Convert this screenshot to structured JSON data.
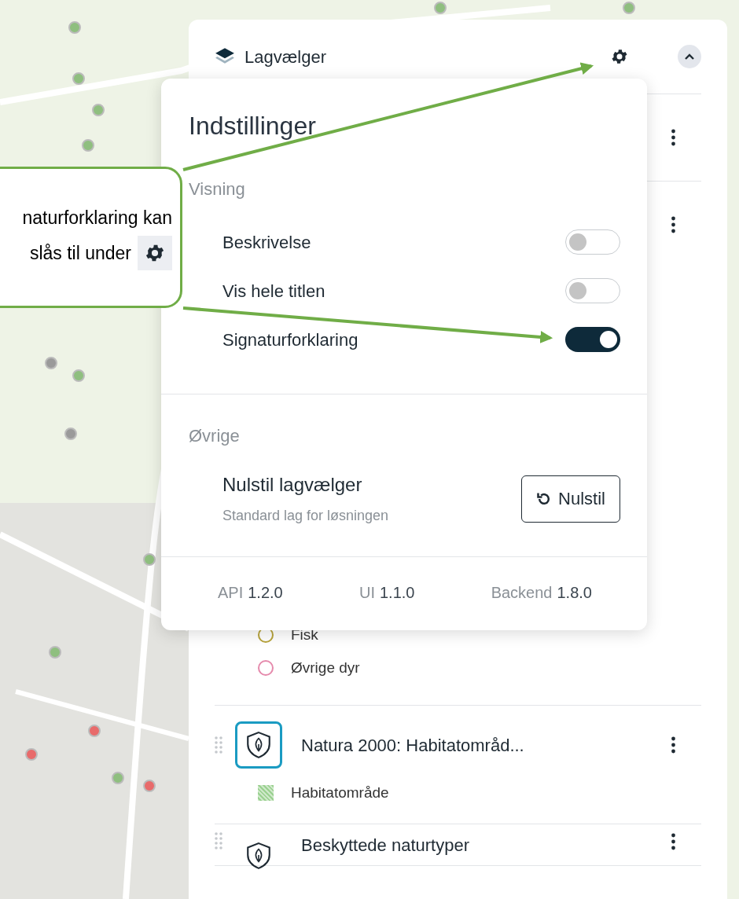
{
  "layer_panel": {
    "title": "Lagvælger",
    "expanded": true
  },
  "layers": [
    {
      "kind": "covered"
    },
    {
      "kind": "covered",
      "legend": [
        {
          "kind": "circle",
          "label": "Fisk",
          "color": "#b8a43c"
        },
        {
          "kind": "circle",
          "label": "Øvrige dyr",
          "color": "#e58aac"
        }
      ]
    },
    {
      "kind": "layer",
      "title": "Natura 2000: Habitatområd...",
      "active": true,
      "legend": [
        {
          "kind": "hatch",
          "label": "Habitatområde",
          "color": "#9bd191"
        }
      ]
    },
    {
      "kind": "layer",
      "title": "Beskyttede naturtyper",
      "active": false
    }
  ],
  "settings": {
    "title": "Indstillinger",
    "sections": [
      {
        "heading": "Visning",
        "toggles": [
          {
            "label": "Beskrivelse",
            "on": false
          },
          {
            "label": "Vis hele titlen",
            "on": false
          },
          {
            "label": "Signaturforklaring",
            "on": true
          }
        ]
      },
      {
        "heading": "Øvrige",
        "reset": {
          "title": "Nulstil lagvælger",
          "subtitle": "Standard lag for løsningen",
          "button": "Nulstil"
        }
      }
    ],
    "versions": [
      {
        "label": "API",
        "value": "1.2.0"
      },
      {
        "label": "UI",
        "value": "1.1.0"
      },
      {
        "label": "Backend",
        "value": "1.8.0"
      }
    ]
  },
  "callout": {
    "lines": [
      "naturforklaring kan",
      "slås til under"
    ]
  }
}
